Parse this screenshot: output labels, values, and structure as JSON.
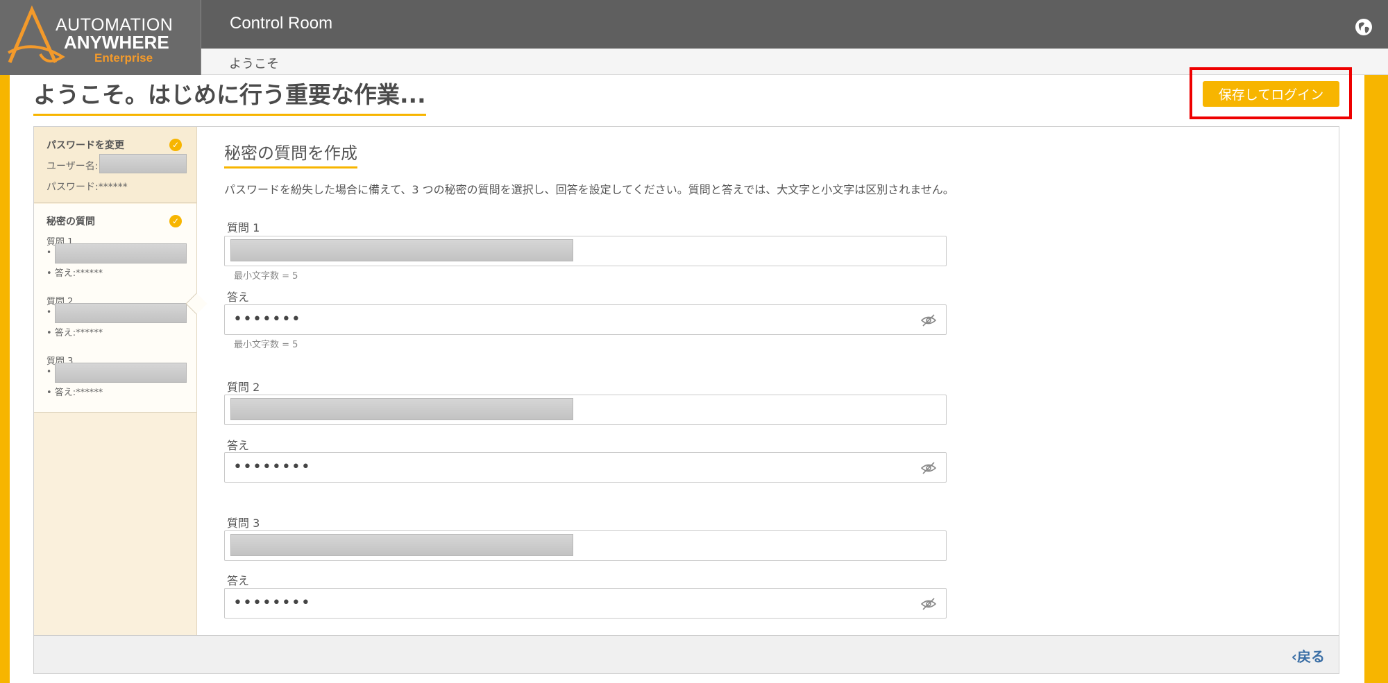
{
  "header": {
    "logo_line1": "AUTOMATION",
    "logo_line2": "ANYWHERE",
    "logo_line3": "Enterprise",
    "app_title": "Control Room",
    "globe_icon": "globe-icon"
  },
  "breadcrumb": "ようこそ",
  "page_title": "ようこそ。はじめに行う重要な作業...",
  "save_button": "保存してログイン",
  "sidebar": {
    "password_card": {
      "title": "パスワードを変更",
      "username_label": "ユーザー名:",
      "password_label": "パスワード:******"
    },
    "questions_card": {
      "title": "秘密の質問",
      "items": [
        {
          "label": "質問 1",
          "bullet": "•",
          "answer": "• 答え:******"
        },
        {
          "label": "質問 2",
          "bullet": "•",
          "answer": "• 答え:******"
        },
        {
          "label": "質問 3",
          "bullet": "•",
          "answer": "• 答え:******"
        }
      ]
    }
  },
  "main": {
    "section_title": "秘密の質問を作成",
    "description": "パスワードを紛失した場合に備えて、3 つの秘密の質問を選択し、回答を設定してください。質問と答えでは、大文字と小文字は区別されません。",
    "questions": [
      {
        "label": "質問 1",
        "hint": "最小文字数 = 5",
        "answer_label": "答え",
        "answer_value": "•••••••",
        "answer_hint": "最小文字数 = 5"
      },
      {
        "label": "質問 2",
        "answer_label": "答え",
        "answer_value": "••••••••"
      },
      {
        "label": "質問 3",
        "answer_label": "答え",
        "answer_value": "••••••••"
      }
    ]
  },
  "footer": {
    "back_label": "‹戻る"
  },
  "colors": {
    "accent": "#f7b500",
    "header_bg": "#5f5f5f",
    "highlight": "#ee0000",
    "link": "#3a6ea5"
  }
}
